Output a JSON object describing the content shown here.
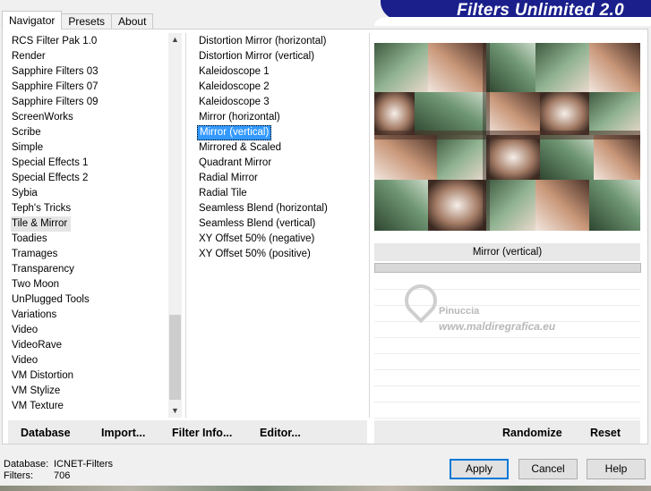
{
  "banner": {
    "title": "Filters Unlimited 2.0"
  },
  "tabs": [
    {
      "label": "Navigator"
    },
    {
      "label": "Presets"
    },
    {
      "label": "About"
    }
  ],
  "categories": {
    "items": [
      "RCS Filter Pak 1.0",
      "Render",
      "Sapphire Filters 03",
      "Sapphire Filters 07",
      "Sapphire Filters 09",
      "ScreenWorks",
      "Scribe",
      "Simple",
      "Special Effects 1",
      "Special Effects 2",
      "Sybia",
      "Teph's Tricks",
      "Tile & Mirror",
      "Toadies",
      "Tramages",
      "Transparency",
      "Two Moon",
      "UnPlugged Tools",
      "Variations",
      "Video",
      "VideoRave",
      "Video",
      "VM Distortion",
      "VM Stylize",
      "VM Texture"
    ],
    "selected": "Tile & Mirror"
  },
  "filters": {
    "items": [
      "Distortion Mirror (horizontal)",
      "Distortion Mirror (vertical)",
      "Kaleidoscope 1",
      "Kaleidoscope 2",
      "Kaleidoscope 3",
      "Mirror (horizontal)",
      "Mirror (vertical)",
      "Mirrored & Scaled",
      "Quadrant Mirror",
      "Radial Mirror",
      "Radial Tile",
      "Seamless Blend (horizontal)",
      "Seamless Blend (vertical)",
      "XY Offset 50% (negative)",
      "XY Offset 50% (positive)"
    ],
    "selected": "Mirror (vertical)"
  },
  "preview": {
    "filter_name": "Mirror (vertical)"
  },
  "watermark": {
    "name": "Pinuccia",
    "url": "www.maldiregrafica.eu"
  },
  "toolbar": {
    "database": "Database",
    "import": "Import...",
    "filter_info": "Filter Info...",
    "editor": "Editor...",
    "randomize": "Randomize",
    "reset": "Reset"
  },
  "status": {
    "database_label": "Database:",
    "database_value": "ICNET-Filters",
    "filters_label": "Filters:",
    "filters_value": "706"
  },
  "buttons": {
    "apply": "Apply",
    "cancel": "Cancel",
    "help": "Help"
  },
  "colors": {
    "accent": "#3399ff",
    "banner": "#1a1f8c",
    "default_button_border": "#0078d7"
  }
}
